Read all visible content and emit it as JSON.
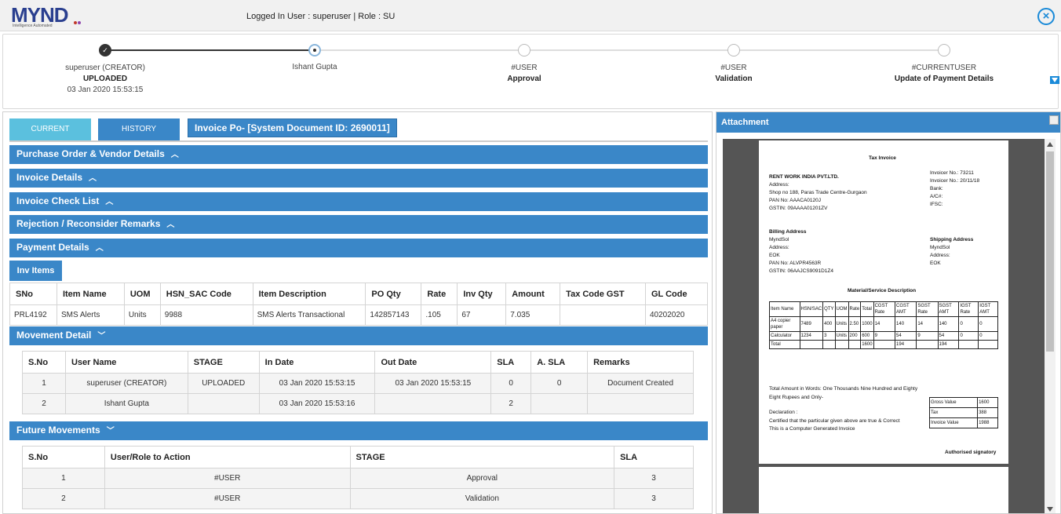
{
  "header": {
    "logo_text": "MYND",
    "logo_tagline": "Intelligence Automated",
    "login_text": "Logged In User : superuser | Role : SU",
    "close_icon": "close-circle-icon"
  },
  "workflow": [
    {
      "line1": "superuser (CREATOR)",
      "line2": "UPLOADED",
      "line3": "03 Jan 2020 15:53:15",
      "state": "done"
    },
    {
      "line1": "Ishant Gupta",
      "line2": "",
      "line3": "",
      "state": "active"
    },
    {
      "line1": "#USER",
      "line2": "Approval",
      "line3": "",
      "state": "pending"
    },
    {
      "line1": "#USER",
      "line2": "Validation",
      "line3": "",
      "state": "pending"
    },
    {
      "line1": "#CURRENTUSER",
      "line2": "Update of Payment Details",
      "line3": "",
      "state": "pending"
    }
  ],
  "tabs": {
    "current": "CURRENT",
    "history": "HISTORY"
  },
  "doc_title": "Invoice Po- [System Document ID: 2690011]",
  "sections": {
    "po_vendor": "Purchase Order & Vendor Details",
    "invoice_details": "Invoice Details",
    "check_list": "Invoice Check List",
    "rejection": "Rejection / Reconsider Remarks",
    "payment": "Payment Details",
    "movement": "Movement Detail",
    "future": "Future Movements"
  },
  "inv_items_tab": "Inv Items",
  "inv_table": {
    "headers": [
      "SNo",
      "Item Name",
      "UOM",
      "HSN_SAC Code",
      "Item Description",
      "PO Qty",
      "Rate",
      "Inv Qty",
      "Amount",
      "Tax Code GST",
      "GL Code"
    ],
    "row": [
      "PRL4192",
      "SMS Alerts",
      "Units",
      "9988",
      "SMS Alerts Transactional",
      "142857143",
      ".105",
      "67",
      "7.035",
      "",
      "40202020"
    ]
  },
  "movement_table": {
    "headers": [
      "S.No",
      "User Name",
      "STAGE",
      "In Date",
      "Out Date",
      "SLA",
      "A. SLA",
      "Remarks"
    ],
    "rows": [
      [
        "1",
        "superuser (CREATOR)",
        "UPLOADED",
        "03 Jan 2020 15:53:15",
        "03 Jan 2020 15:53:15",
        "0",
        "0",
        "Document Created"
      ],
      [
        "2",
        "Ishant Gupta",
        "",
        "03 Jan 2020 15:53:16",
        "",
        "2",
        "",
        ""
      ]
    ]
  },
  "future_table": {
    "headers": [
      "S.No",
      "User/Role to Action",
      "STAGE",
      "SLA"
    ],
    "rows": [
      [
        "1",
        "#USER",
        "Approval",
        "3"
      ],
      [
        "2",
        "#USER",
        "Validation",
        "3"
      ]
    ]
  },
  "attachment": {
    "title": "Attachment",
    "invoice": {
      "heading": "Tax Invoice",
      "company": "RENT WORK INDIA PVT.LTD.",
      "address_label": "Address:",
      "address": "Shop no 188, Paras Trade Centre-Gurgaon",
      "pan": "PAN No: AAACA0120J",
      "gstin": "GSTIN: 09AAAA01201ZV",
      "invoice_no": "Invoicer No.: 73211",
      "invoice_date": "Invoicer No.: 20/11/18",
      "bank": "Bank:",
      "acc": "A/C#:",
      "ifsc": "IFSC:",
      "billing_label": "Billing Address",
      "billing_name": "MyndSol",
      "billing_address": "Address:",
      "billing_city": "EOK",
      "billing_pan": "PAN No: ALVPR4563R",
      "billing_gstin": "GSTIN: 06AAJCS9091D1Z4",
      "shipping_label": "Shipping Address",
      "shipping_name": "MyndSol",
      "shipping_address": "Address:",
      "shipping_city": "EOK",
      "material_label": "Material/Service Description",
      "mat_headers": [
        "Item Name",
        "HSN/SAC",
        "QTY",
        "UOM",
        "Rate",
        "Total",
        "CGST Rate",
        "CGST AMT",
        "SGST Rate",
        "SGST AMT",
        "IGST Rate",
        "IGST AMT"
      ],
      "mat_rows": [
        [
          "A4 copier paper",
          "7489",
          "400",
          "Units",
          "2.50",
          "1000",
          "14",
          "140",
          "14",
          "140",
          "0",
          "0"
        ],
        [
          "Calculator",
          "1234",
          "3",
          "Units",
          "200",
          "600",
          "9",
          "54",
          "9",
          "54",
          "0",
          "0"
        ],
        [
          "Total",
          "",
          "",
          "",
          "",
          "1600",
          "",
          "194",
          "",
          "194",
          "",
          ""
        ]
      ],
      "amount_words": "Total Amount in Words: One Thousands Nine Hundred and Eighty",
      "amount_words2": "Eight Rupees and Only-",
      "declaration": "Declaration :",
      "certified": "Certified that the particular given above are true & Correct",
      "computer_generated": "This is a Computer Generated Invoice",
      "totals": [
        [
          "Gross Value",
          "1600"
        ],
        [
          "Tax",
          "388"
        ],
        [
          "Invoice Value",
          "1988"
        ]
      ],
      "signatory": "Authorised signatory"
    }
  }
}
